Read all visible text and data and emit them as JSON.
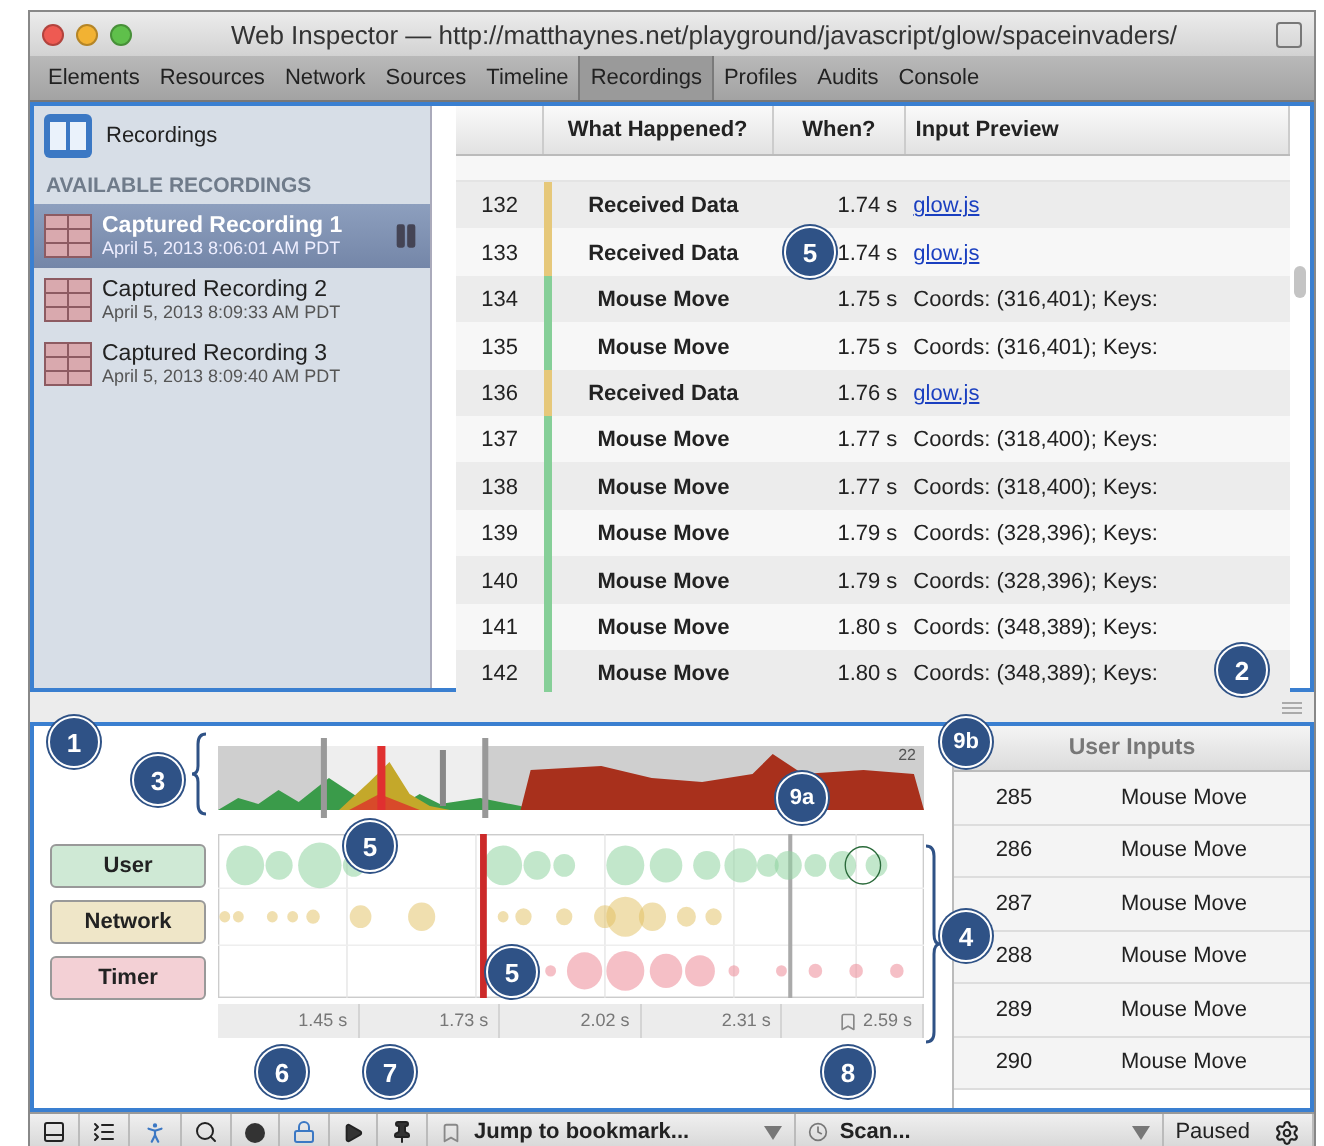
{
  "window": {
    "title": "Web Inspector — http://matthaynes.net/playground/javascript/glow/spaceinvaders/"
  },
  "tabs": [
    {
      "label": "Elements",
      "selected": false
    },
    {
      "label": "Resources",
      "selected": false
    },
    {
      "label": "Network",
      "selected": false
    },
    {
      "label": "Sources",
      "selected": false
    },
    {
      "label": "Timeline",
      "selected": false
    },
    {
      "label": "Recordings",
      "selected": true
    },
    {
      "label": "Profiles",
      "selected": false
    },
    {
      "label": "Audits",
      "selected": false
    },
    {
      "label": "Console",
      "selected": false
    }
  ],
  "sidebar": {
    "header": "Recordings",
    "section": "AVAILABLE RECORDINGS",
    "items": [
      {
        "title": "Captured Recording 1",
        "date": "April 5, 2013 8:06:01 AM PDT",
        "selected": true
      },
      {
        "title": "Captured Recording 2",
        "date": "April 5, 2013 8:09:33 AM PDT",
        "selected": false
      },
      {
        "title": "Captured Recording 3",
        "date": "April 5, 2013 8:09:40 AM PDT",
        "selected": false
      }
    ]
  },
  "table": {
    "columns": [
      "What Happened?",
      "When?",
      "Input Preview"
    ],
    "rows": [
      {
        "index": "132",
        "kind": "network",
        "event": "Received Data",
        "time": "1.74 s",
        "preview": "glow.js"
      },
      {
        "index": "133",
        "kind": "network",
        "event": "Received Data",
        "time": "1.74 s",
        "preview": "glow.js"
      },
      {
        "index": "134",
        "kind": "user",
        "event": "Mouse Move",
        "time": "1.75 s",
        "preview": "Coords: (316,401); Keys:"
      },
      {
        "index": "135",
        "kind": "user",
        "event": "Mouse Move",
        "time": "1.75 s",
        "preview": "Coords: (316,401); Keys:"
      },
      {
        "index": "136",
        "kind": "network",
        "event": "Received Data",
        "time": "1.76 s",
        "preview": "glow.js"
      },
      {
        "index": "137",
        "kind": "user",
        "event": "Mouse Move",
        "time": "1.77 s",
        "preview": "Coords: (318,400); Keys:"
      },
      {
        "index": "138",
        "kind": "user",
        "event": "Mouse Move",
        "time": "1.77 s",
        "preview": "Coords: (318,400); Keys:"
      },
      {
        "index": "139",
        "kind": "user",
        "event": "Mouse Move",
        "time": "1.79 s",
        "preview": "Coords: (328,396); Keys:"
      },
      {
        "index": "140",
        "kind": "user",
        "event": "Mouse Move",
        "time": "1.79 s",
        "preview": "Coords: (328,396); Keys:"
      },
      {
        "index": "141",
        "kind": "user",
        "event": "Mouse Move",
        "time": "1.80 s",
        "preview": "Coords: (348,389); Keys:"
      },
      {
        "index": "142",
        "kind": "user",
        "event": "Mouse Move",
        "time": "1.80 s",
        "preview": "Coords: (348,389); Keys:"
      }
    ]
  },
  "timeline": {
    "overview_label": "22",
    "categories": [
      {
        "label": "User",
        "color": "#cfe9d5"
      },
      {
        "label": "Network",
        "color": "#efe6c8"
      },
      {
        "label": "Timer",
        "color": "#f3d0d5"
      }
    ],
    "ticks": [
      "1.45 s",
      "1.73 s",
      "2.02 s",
      "2.31 s",
      "2.59 s"
    ]
  },
  "user_inputs": {
    "title": "User Inputs",
    "rows": [
      {
        "index": "285",
        "event": "Mouse Move"
      },
      {
        "index": "286",
        "event": "Mouse Move"
      },
      {
        "index": "287",
        "event": "Mouse Move"
      },
      {
        "index": "288",
        "event": "Mouse Move"
      },
      {
        "index": "289",
        "event": "Mouse Move"
      },
      {
        "index": "290",
        "event": "Mouse Move"
      }
    ]
  },
  "toolbar": {
    "bookmark": "Jump to bookmark...",
    "scan": "Scan...",
    "status": "Paused"
  },
  "callouts": [
    "5",
    "2",
    "1",
    "3",
    "5",
    "9a",
    "9b",
    "4",
    "5",
    "6",
    "7",
    "8"
  ]
}
